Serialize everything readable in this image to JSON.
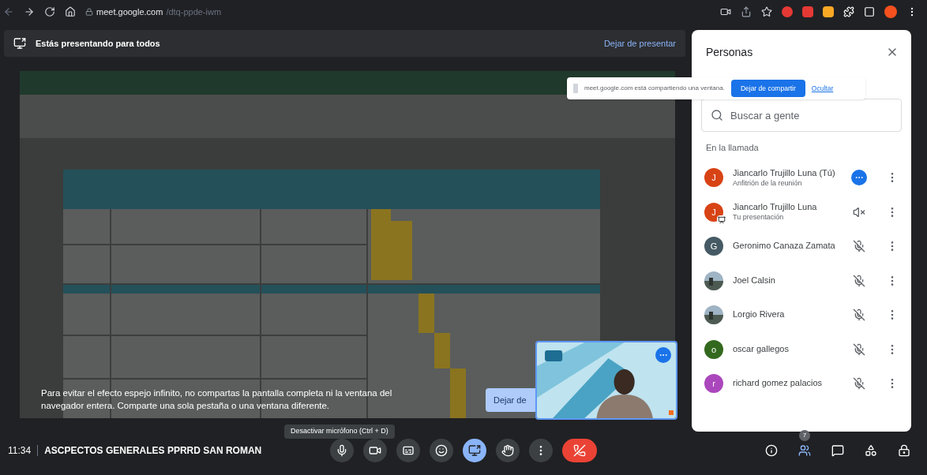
{
  "browser": {
    "url_host": "meet.google.com",
    "url_path": "/dtq-ppde-iwm"
  },
  "banner": {
    "text": "Estás presentando para todos",
    "action": "Dejar de presentar"
  },
  "share_notice": {
    "text": "meet.google.com está compartiendo una ventana.",
    "stop": "Dejar de compartir",
    "hide": "Ocultar"
  },
  "warning": "Para evitar el efecto espejo infinito, no compartas la pantalla completa ni la ventana del navegador entera. Comparte una sola pestaña o una ventana diferente.",
  "stop_button": "Dejar de",
  "people_panel": {
    "title": "Personas",
    "search": {
      "placeholder": "Buscar a gente"
    },
    "section": "En la llamada",
    "participants": [
      {
        "kind": "letter",
        "name": "Jiancarlo Trujillo Luna (Tú)",
        "subtitle": "Anfitrión de la reunión",
        "initial": "J",
        "color": "#d84315",
        "speaking": true,
        "presenting": false
      },
      {
        "kind": "letter",
        "name": "Jiancarlo Trujillo Luna",
        "subtitle": "Tu presentación",
        "initial": "J",
        "color": "#d84315",
        "speaking": false,
        "muted": true,
        "presenting": true
      },
      {
        "kind": "letter",
        "name": "Geronimo Canaza Zamata",
        "initial": "G",
        "color": "#455a64",
        "speaking": false,
        "muted": true,
        "presenting": false
      },
      {
        "kind": "picture",
        "name": "Joel Calsin",
        "speaking": false,
        "muted": true,
        "presenting": false
      },
      {
        "kind": "picture",
        "name": "Lorgio Rivera",
        "speaking": false,
        "muted": true,
        "presenting": false
      },
      {
        "kind": "letter",
        "name": "oscar gallegos",
        "initial": "o",
        "color": "#33691e",
        "speaking": false,
        "muted": true,
        "presenting": false
      },
      {
        "kind": "letter",
        "name": "richard gomez palacios",
        "initial": "r",
        "color": "#ab47bc",
        "speaking": false,
        "muted": true,
        "presenting": false
      }
    ]
  },
  "meeting": {
    "time": "11:34",
    "title": "ASCPECTOS GENERALES PPRRD SAN ROMAN"
  },
  "tooltip": "Desactivar micrófono (Ctrl + D)",
  "controls": [
    {
      "kind": "mic",
      "selected": false
    },
    {
      "kind": "camera",
      "selected": false
    },
    {
      "kind": "captions",
      "selected": false
    },
    {
      "kind": "emoji",
      "selected": false
    },
    {
      "kind": "present",
      "selected": true
    },
    {
      "kind": "hand",
      "selected": false
    },
    {
      "kind": "more",
      "selected": false
    },
    {
      "kind": "end_call",
      "selected": false
    }
  ],
  "side_controls": [
    {
      "kind": "info",
      "selected": false
    },
    {
      "kind": "people",
      "selected": true,
      "badge": "7"
    },
    {
      "kind": "chat",
      "selected": false
    },
    {
      "kind": "activities",
      "selected": false
    },
    {
      "kind": "host_controls",
      "selected": false
    }
  ]
}
